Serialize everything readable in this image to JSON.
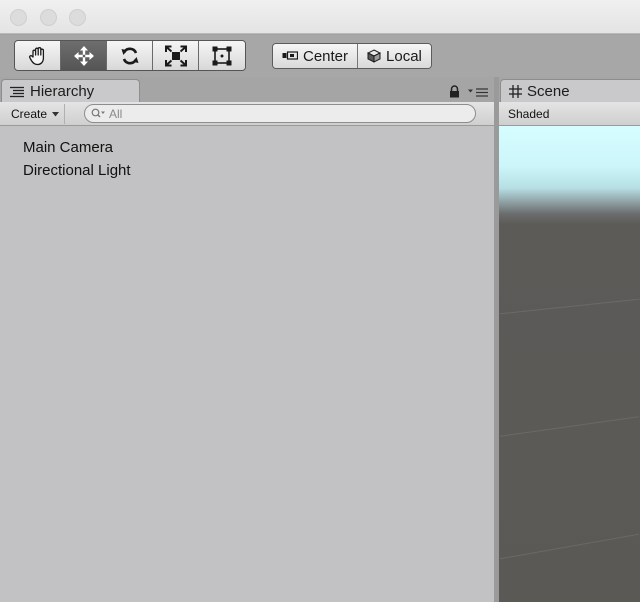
{
  "window": {
    "traffic_lights": [
      "close",
      "minimize",
      "zoom"
    ]
  },
  "toolbar": {
    "transform_tools": [
      {
        "name": "hand-tool",
        "icon": "hand-icon",
        "active": false
      },
      {
        "name": "move-tool",
        "icon": "move-arrows-icon",
        "active": true
      },
      {
        "name": "rotate-tool",
        "icon": "rotate-icon",
        "active": false
      },
      {
        "name": "scale-tool",
        "icon": "scale-icon",
        "active": false
      },
      {
        "name": "rect-tool",
        "icon": "rect-transform-icon",
        "active": false
      }
    ],
    "pivot_position_label": "Center",
    "pivot_rotation_label": "Local"
  },
  "hierarchy": {
    "tab_label": "Hierarchy",
    "create_label": "Create",
    "search_placeholder": "All",
    "items": [
      "Main Camera",
      "Directional Light"
    ]
  },
  "scene": {
    "tab_label": "Scene",
    "shading_mode": "Shaded"
  },
  "colors": {
    "panel_bg": "#c2c1c3",
    "toolbar_bg": "#a7a7a7",
    "active_tool": "#5a5a5a",
    "sky_top": "#d6fdff",
    "ground": "#5b5956"
  }
}
